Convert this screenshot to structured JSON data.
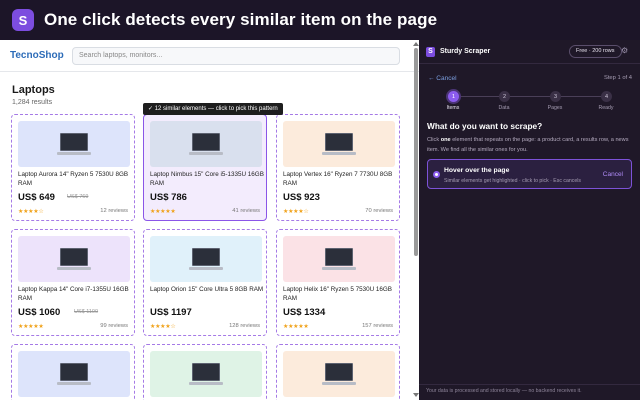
{
  "banner": {
    "logo_letter": "S",
    "title": "One click detects every similar item on the page"
  },
  "site": {
    "brand": "TecnoShop",
    "search_placeholder": "Search laptops, monitors...",
    "heading": "Laptops",
    "results": "1,284 results",
    "tooltip": "✓ 12 similar elements — click to pick this pattern",
    "products": [
      {
        "name": "Laptop Aurora 14\" Ryzen 5 7530U 8GB RAM",
        "price": "US$ 649",
        "old_price": "US$ 769",
        "stars": "★★★★☆",
        "reviews": "12 reviews",
        "thumb": "#dde4fb"
      },
      {
        "name": "Laptop Nimbus 15\" Core i5-1335U 16GB RAM",
        "price": "US$ 786",
        "old_price": "",
        "stars": "★★★★★",
        "reviews": "41 reviews",
        "thumb": "#d9e0ee"
      },
      {
        "name": "Laptop Vertex 16\" Ryzen 7 7730U 8GB RAM",
        "price": "US$ 923",
        "old_price": "",
        "stars": "★★★★☆",
        "reviews": "70 reviews",
        "thumb": "#fcebdc"
      },
      {
        "name": "Laptop Kappa 14\" Core i7-1355U 16GB RAM",
        "price": "US$ 1060",
        "old_price": "US$ 1100",
        "stars": "★★★★★",
        "reviews": "99 reviews",
        "thumb": "#ede3fb"
      },
      {
        "name": "Laptop Orion 15\" Core Ultra 5 8GB RAM",
        "price": "US$ 1197",
        "old_price": "",
        "stars": "★★★★☆",
        "reviews": "128 reviews",
        "thumb": "#e0f1fa"
      },
      {
        "name": "Laptop Helix 16\" Ryzen 5 7530U 16GB RAM",
        "price": "US$ 1334",
        "old_price": "",
        "stars": "★★★★★",
        "reviews": "157 reviews",
        "thumb": "#fbe2e6"
      },
      {
        "thumb": "#dde4fb"
      },
      {
        "thumb": "#dff3e6"
      },
      {
        "thumb": "#fcebdc"
      }
    ]
  },
  "panel": {
    "logo_letter": "S",
    "name": "Sturdy Scraper",
    "plan": "Free · 200 rows",
    "cancel": "← Cancel",
    "step_of": "Step 1 of 4",
    "steps": [
      {
        "num": "1",
        "label": "Items"
      },
      {
        "num": "2",
        "label": "Data"
      },
      {
        "num": "3",
        "label": "Pages"
      },
      {
        "num": "4",
        "label": "Ready"
      }
    ],
    "question": "What do you want to scrape?",
    "desc_pre": "Click ",
    "desc_bold": "one",
    "desc_post": " element that repeats on the page: a product card, a results row, a news item. We find all the similar ones for you.",
    "hover_title": "Hover over the page",
    "hover_sub": "Similar elements get highlighted · click to pick · Esc cancels",
    "hover_cancel": "Cancel",
    "footer": "Your data is processed and stored locally — no backend receives it."
  }
}
